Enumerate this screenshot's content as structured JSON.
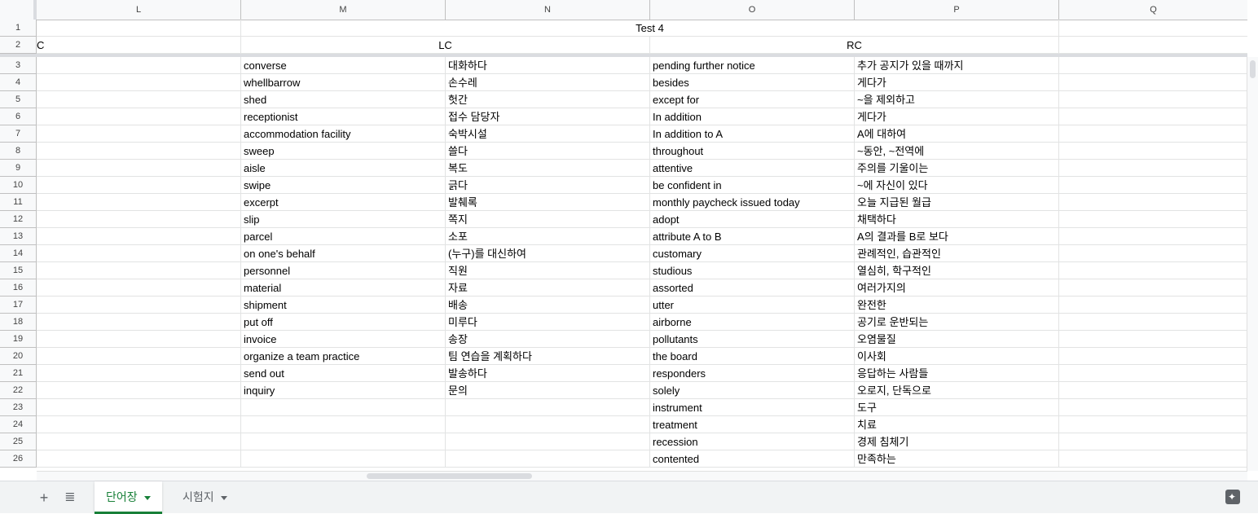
{
  "columns": [
    "L",
    "M",
    "N",
    "O",
    "P",
    "Q"
  ],
  "frozen_rows": [
    {
      "num": "1",
      "o_merged": "Test 4"
    },
    {
      "num": "2",
      "l_text": "C",
      "lc": "LC",
      "rc": "RC"
    }
  ],
  "rows": [
    {
      "num": "3",
      "m": "converse",
      "n": "대화하다",
      "o": "pending further notice",
      "p": "추가 공지가 있을 때까지"
    },
    {
      "num": "4",
      "m": "whellbarrow",
      "n": "손수레",
      "o": "besides",
      "p": "게다가"
    },
    {
      "num": "5",
      "m": "shed",
      "n": "헛간",
      "o": "except for",
      "p": "~을 제외하고"
    },
    {
      "num": "6",
      "m": "receptionist",
      "n": "접수 담당자",
      "o": "In addition",
      "p": "게다가"
    },
    {
      "num": "7",
      "m": "accommodation facility",
      "n": "숙박시설",
      "o": "In addition to A",
      "p": "A에 대하여"
    },
    {
      "num": "8",
      "m": "sweep",
      "n": "쓸다",
      "o": "throughout",
      "p": "~동안, ~전역에"
    },
    {
      "num": "9",
      "m": "aisle",
      "n": "복도",
      "o": "attentive",
      "p": "주의를 기울이는"
    },
    {
      "num": "10",
      "m": "swipe",
      "n": "긁다",
      "o": "be confident in",
      "p": "~에 자신이 있다"
    },
    {
      "num": "11",
      "m": "excerpt",
      "n": "발췌록",
      "o": "monthly paycheck issued today",
      "p": "오늘 지급된 월급"
    },
    {
      "num": "12",
      "m": "slip",
      "n": "쪽지",
      "o": "adopt",
      "p": "채택하다"
    },
    {
      "num": "13",
      "m": "parcel",
      "n": "소포",
      "o": "attribute A to B",
      "p": "A의 결과를 B로 보다"
    },
    {
      "num": "14",
      "m": "on one's behalf",
      "n": "(누구)를 대신하여",
      "o": "customary",
      "p": "관례적인, 습관적인"
    },
    {
      "num": "15",
      "m": "personnel",
      "n": "직원",
      "o": "studious",
      "p": "열심히, 학구적인"
    },
    {
      "num": "16",
      "m": "material",
      "n": "자료",
      "o": "assorted",
      "p": "여러가지의"
    },
    {
      "num": "17",
      "m": "shipment",
      "n": "배송",
      "o": "utter",
      "p": "완전한"
    },
    {
      "num": "18",
      "m": "put off",
      "n": "미루다",
      "o": "airborne",
      "p": "공기로 운반되는"
    },
    {
      "num": "19",
      "m": "invoice",
      "n": "송장",
      "o": "pollutants",
      "p": "오염물질"
    },
    {
      "num": "20",
      "m": "organize a team practice",
      "n": "팀 연습을 계획하다",
      "o": "the board",
      "p": "이사회"
    },
    {
      "num": "21",
      "m": "send out",
      "n": "발송하다",
      "o": "responders",
      "p": "응답하는 사람들"
    },
    {
      "num": "22",
      "m": "inquiry",
      "n": "문의",
      "o": "solely",
      "p": "오로지, 단독으로"
    },
    {
      "num": "23",
      "m": "",
      "n": "",
      "o": "instrument",
      "p": "도구"
    },
    {
      "num": "24",
      "m": "",
      "n": "",
      "o": "treatment",
      "p": "치료"
    },
    {
      "num": "25",
      "m": "",
      "n": "",
      "o": "recession",
      "p": "경제 침체기"
    },
    {
      "num": "26",
      "m": "",
      "n": "",
      "o": "contented",
      "p": "만족하는"
    }
  ],
  "tabs": [
    {
      "label": "단어장",
      "active": true
    },
    {
      "label": "시험지",
      "active": false
    }
  ],
  "icons": {
    "add": "plus-icon",
    "all_sheets": "list-icon",
    "explore": "explore-icon"
  },
  "colors": {
    "active_tab": "#188038",
    "header_bg": "#f8f9fa",
    "grid_line": "#e2e3e3"
  }
}
